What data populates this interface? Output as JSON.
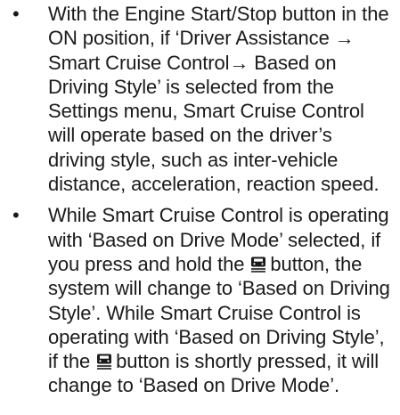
{
  "bullets": [
    {
      "marker": "•",
      "text": "With the Engine Start/Stop button in the ON position, if ‘Driver Assistance → Smart Cruise Control→ Based on Driving Style’ is selected from the Settings menu, Smart Cruise Control will operate based on the driver’s driving style, such as inter-vehicle distance, acceleration, reaction speed."
    },
    {
      "marker": "•",
      "part1": "While Smart Cruise Control is operating with ‘Based on Drive Mode’ selected, if you press and hold the",
      "part2": "button, the system will change to ‘Based on Driving Style’. While Smart Cruise Control is operating with ‘Based on Driving Style’, if the",
      "part3": "button is shortly pressed, it will change to ‘Based on Drive Mode’."
    }
  ],
  "icons": {
    "cruise_button": "vehicle-distance-icon",
    "color": "#1a1a1a"
  }
}
